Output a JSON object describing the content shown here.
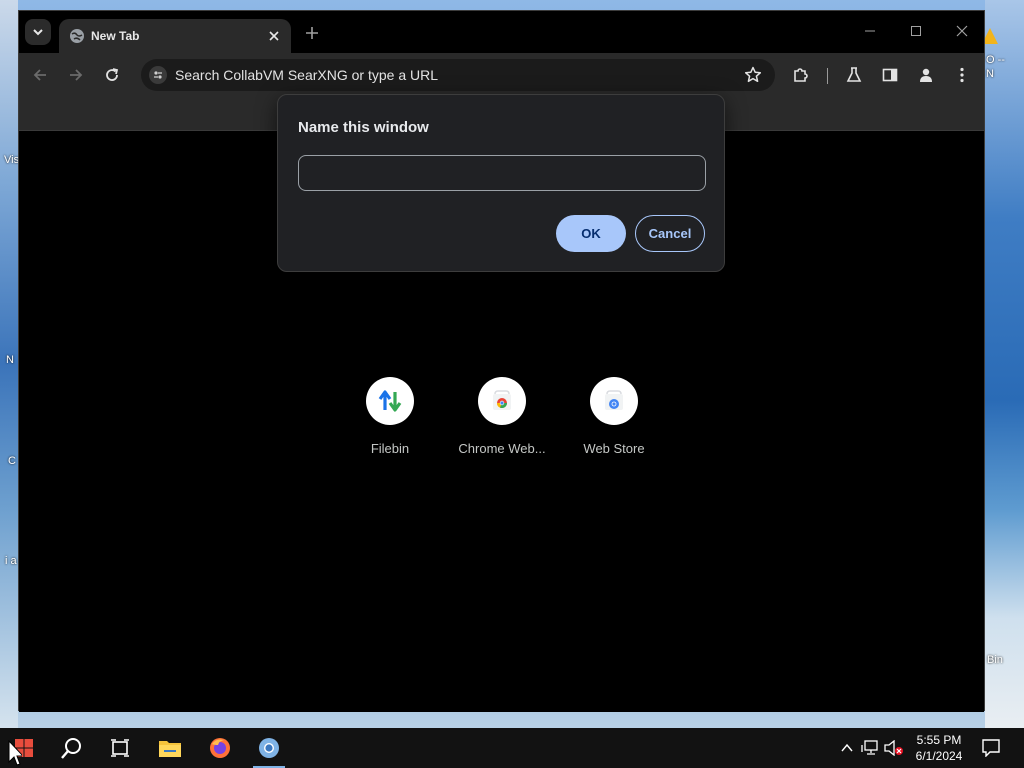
{
  "desktop": {
    "left_labels": [
      "Vis",
      "N",
      "C",
      "i a"
    ],
    "right_labels": [
      "O --",
      "N",
      "Bin"
    ]
  },
  "browser": {
    "tab": {
      "title": "New Tab"
    },
    "omnibox": {
      "placeholder": "Search CollabVM SearXNG or type a URL"
    },
    "shortcuts": [
      {
        "label": "Filebin",
        "icon": "filebin-icon"
      },
      {
        "label": "Chrome Web...",
        "icon": "chrome-web-store-icon"
      },
      {
        "label": "Web Store",
        "icon": "web-store-icon"
      }
    ]
  },
  "dialog": {
    "title": "Name this window",
    "input_value": "",
    "ok_label": "OK",
    "cancel_label": "Cancel"
  },
  "taskbar": {
    "time": "5:55 PM",
    "date": "6/1/2024"
  }
}
